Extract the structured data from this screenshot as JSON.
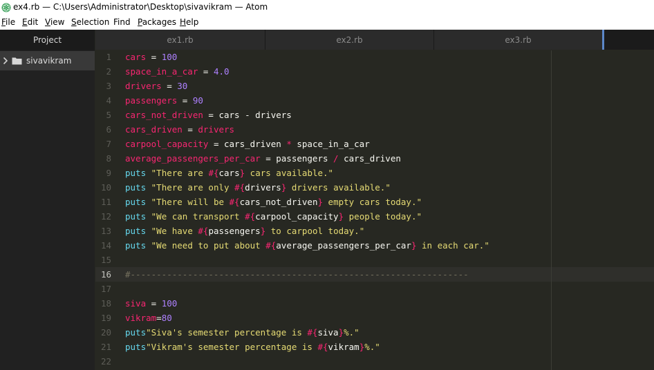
{
  "window": {
    "title": "ex4.rb — C:\\Users\\Administrator\\Desktop\\sivavikram — Atom",
    "app_icon": "atom-icon"
  },
  "menu": [
    {
      "label": "File",
      "accel": "F",
      "rest": "ile"
    },
    {
      "label": "Edit",
      "accel": "E",
      "rest": "dit"
    },
    {
      "label": "View",
      "accel": "V",
      "rest": "iew"
    },
    {
      "label": "Selection",
      "accel": "S",
      "rest": "election"
    },
    {
      "label": "Find",
      "accel": "F",
      "pre": "",
      "rest": "ind"
    },
    {
      "label": "Packages",
      "accel": "P",
      "rest": "ackages"
    },
    {
      "label": "Help",
      "accel": "H",
      "rest": "elp"
    }
  ],
  "tree": {
    "header": "Project",
    "root_folder": "sivavikram",
    "icons": [
      "chevron-right-icon",
      "folder-icon"
    ]
  },
  "tabs": [
    "ex1.rb",
    "ex2.rb",
    "ex3.rb"
  ],
  "colors": {
    "background": "#272822",
    "variable": "#f92672",
    "number": "#ae81ff",
    "string": "#e6db74",
    "keyword": "#66d9ef",
    "operator": "#f8f8f2",
    "comment": "#75715e",
    "interp": "#f92672",
    "accent": "#5c87c8"
  },
  "editor": {
    "active_line": 16,
    "lines": [
      {
        "n": "1",
        "tokens": [
          [
            "cars",
            "variable"
          ],
          [
            " = ",
            "operator"
          ],
          [
            "100",
            "number"
          ]
        ]
      },
      {
        "n": "2",
        "tokens": [
          [
            "space_in_a_car",
            "variable"
          ],
          [
            " = ",
            "operator"
          ],
          [
            "4.0",
            "number"
          ]
        ]
      },
      {
        "n": "3",
        "tokens": [
          [
            "drivers",
            "variable"
          ],
          [
            " = ",
            "operator"
          ],
          [
            "30",
            "number"
          ]
        ]
      },
      {
        "n": "4",
        "tokens": [
          [
            "passengers",
            "variable"
          ],
          [
            " = ",
            "operator"
          ],
          [
            "90",
            "number"
          ]
        ]
      },
      {
        "n": "5",
        "tokens": [
          [
            "cars_not_driven",
            "variable"
          ],
          [
            " = ",
            "operator"
          ],
          [
            "cars",
            "operator"
          ],
          [
            " - ",
            "operator"
          ],
          [
            "drivers",
            "operator"
          ]
        ]
      },
      {
        "n": "6",
        "tokens": [
          [
            "cars_driven",
            "variable"
          ],
          [
            " = ",
            "operator"
          ],
          [
            "drivers",
            "variable"
          ]
        ]
      },
      {
        "n": "7",
        "tokens": [
          [
            "carpool_capacity",
            "variable"
          ],
          [
            " = ",
            "operator"
          ],
          [
            "cars_driven",
            "operator"
          ],
          [
            " * ",
            "variable"
          ],
          [
            "space_in_a_car",
            "operator"
          ]
        ]
      },
      {
        "n": "8",
        "tokens": [
          [
            "average_passengers_per_car",
            "variable"
          ],
          [
            " = ",
            "operator"
          ],
          [
            "passengers",
            "operator"
          ],
          [
            " / ",
            "variable"
          ],
          [
            "cars_driven",
            "operator"
          ]
        ]
      },
      {
        "n": "9",
        "tokens": [
          [
            "puts ",
            "keyword"
          ],
          [
            "\"There are ",
            "string"
          ],
          [
            "#{",
            "interp"
          ],
          [
            "cars",
            "operator"
          ],
          [
            "}",
            "interp"
          ],
          [
            " cars available.\"",
            "string"
          ]
        ]
      },
      {
        "n": "10",
        "tokens": [
          [
            "puts ",
            "keyword"
          ],
          [
            "\"There are only ",
            "string"
          ],
          [
            "#{",
            "interp"
          ],
          [
            "drivers",
            "operator"
          ],
          [
            "}",
            "interp"
          ],
          [
            " drivers available.\"",
            "string"
          ]
        ]
      },
      {
        "n": "11",
        "tokens": [
          [
            "puts ",
            "keyword"
          ],
          [
            "\"There will be ",
            "string"
          ],
          [
            "#{",
            "interp"
          ],
          [
            "cars_not_driven",
            "operator"
          ],
          [
            "}",
            "interp"
          ],
          [
            " empty cars today.\"",
            "string"
          ]
        ]
      },
      {
        "n": "12",
        "tokens": [
          [
            "puts ",
            "keyword"
          ],
          [
            "\"We can transport ",
            "string"
          ],
          [
            "#{",
            "interp"
          ],
          [
            "carpool_capacity",
            "operator"
          ],
          [
            "}",
            "interp"
          ],
          [
            " people today.\"",
            "string"
          ]
        ]
      },
      {
        "n": "13",
        "tokens": [
          [
            "puts ",
            "keyword"
          ],
          [
            "\"We have ",
            "string"
          ],
          [
            "#{",
            "interp"
          ],
          [
            "passengers",
            "operator"
          ],
          [
            "}",
            "interp"
          ],
          [
            " to carpool today.\"",
            "string"
          ]
        ]
      },
      {
        "n": "14",
        "tokens": [
          [
            "puts ",
            "keyword"
          ],
          [
            "\"We need to put about ",
            "string"
          ],
          [
            "#{",
            "interp"
          ],
          [
            "average_passengers_per_car",
            "operator"
          ],
          [
            "}",
            "interp"
          ],
          [
            " in each car.\"",
            "string"
          ]
        ]
      },
      {
        "n": "15",
        "tokens": []
      },
      {
        "n": "16",
        "tokens": [
          [
            "#-----------------------------------------------------------------",
            "comment"
          ]
        ]
      },
      {
        "n": "17",
        "tokens": []
      },
      {
        "n": "18",
        "tokens": [
          [
            "siva",
            "variable"
          ],
          [
            " = ",
            "operator"
          ],
          [
            "100",
            "number"
          ]
        ]
      },
      {
        "n": "19",
        "tokens": [
          [
            "vikram",
            "variable"
          ],
          [
            "=",
            "operator"
          ],
          [
            "80",
            "number"
          ]
        ]
      },
      {
        "n": "20",
        "tokens": [
          [
            "puts",
            "keyword"
          ],
          [
            "\"Siva's semester percentage is ",
            "string"
          ],
          [
            "#{",
            "interp"
          ],
          [
            "siva",
            "operator"
          ],
          [
            "}",
            "interp"
          ],
          [
            "%.\"",
            "string"
          ]
        ]
      },
      {
        "n": "21",
        "tokens": [
          [
            "puts",
            "keyword"
          ],
          [
            "\"Vikram's semester percentage is ",
            "string"
          ],
          [
            "#{",
            "interp"
          ],
          [
            "vikram",
            "operator"
          ],
          [
            "}",
            "interp"
          ],
          [
            "%.\"",
            "string"
          ]
        ]
      },
      {
        "n": "22",
        "tokens": []
      }
    ]
  }
}
